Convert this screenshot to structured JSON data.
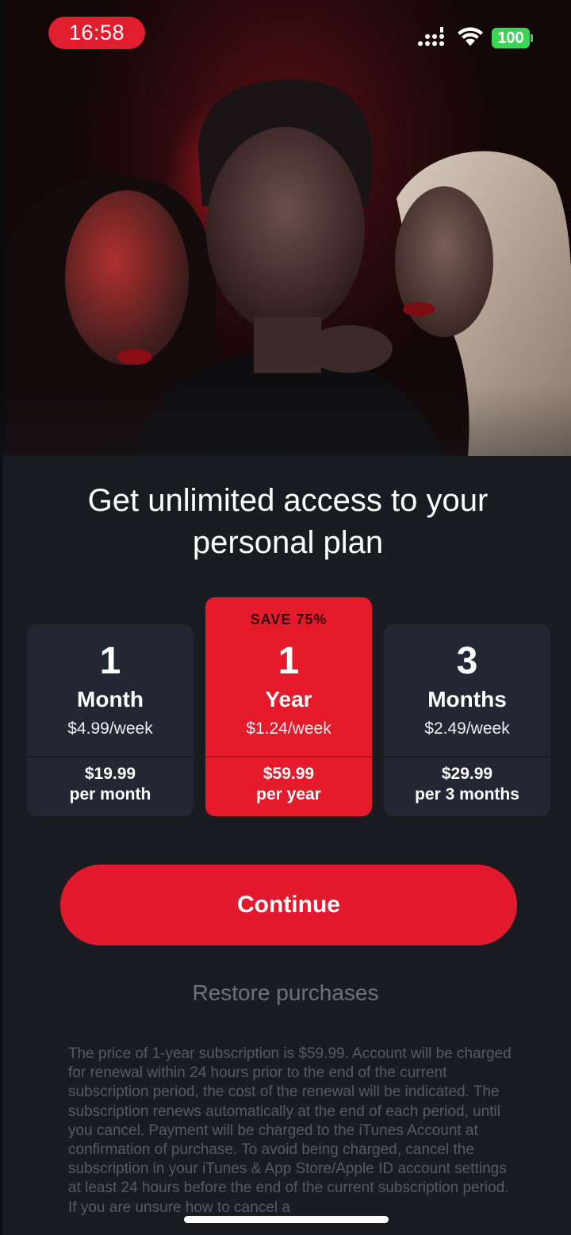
{
  "status_bar": {
    "time": "16:58",
    "battery": "100",
    "colors": {
      "time_pill": "#e01e30",
      "battery": "#3bd556"
    }
  },
  "hero": {
    "image": "illustration-three-people-red-light"
  },
  "heading": "Get unlimited access to your personal plan",
  "plans": [
    {
      "number": "1",
      "unit": "Month",
      "weekly": "$4.99/week",
      "price": "$19.99",
      "period": "per month",
      "selected": false
    },
    {
      "badge": "SAVE 75%",
      "number": "1",
      "unit": "Year",
      "weekly": "$1.24/week",
      "price": "$59.99",
      "period": "per year",
      "selected": true
    },
    {
      "number": "3",
      "unit": "Months",
      "weekly": "$2.49/week",
      "price": "$29.99",
      "period": "per 3 months",
      "selected": false
    }
  ],
  "continue_label": "Continue",
  "restore_label": "Restore purchases",
  "legal_text": "The price of 1-year subscription is $59.99. Account will be charged for renewal within 24 hours prior to the end of the current subscription period, the cost of the renewal will be indicated. The subscription renews automatically at the end of each period, until you cancel. Payment will be charged to the iTunes Account at confirmation of purchase. To avoid being charged, cancel the subscription in your iTunes & App Store/Apple ID account settings at least 24 hours before the end of the current subscription period. If you are unsure how to cancel a",
  "colors": {
    "accent": "#e51b2c",
    "background": "#1b1c21",
    "card": "#232733"
  }
}
